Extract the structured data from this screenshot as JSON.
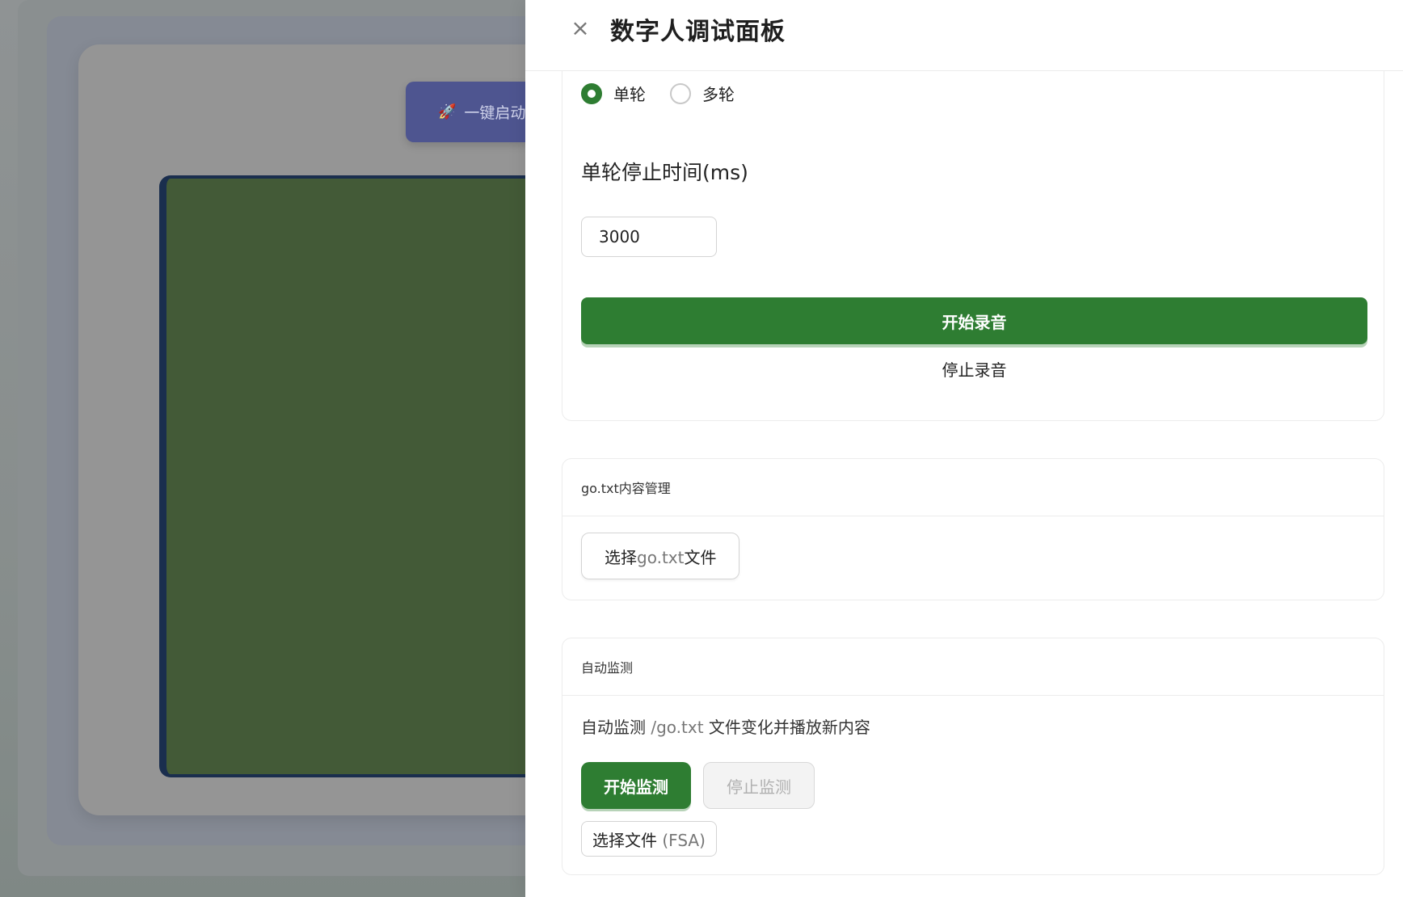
{
  "background": {
    "launch_button": {
      "icon": "rocket-icon",
      "label": "一键启动"
    }
  },
  "drawer": {
    "title": "数字人调试面板",
    "close_icon": "close-icon"
  },
  "record": {
    "mode_options": [
      "单轮",
      "多轮"
    ],
    "selected_mode": "单轮",
    "stop_time_label": "单轮停止时间(ms)",
    "stop_time_value": "3000",
    "start_label": "开始录音",
    "stop_label": "停止录音"
  },
  "gotxt": {
    "title": "go.txt内容管理",
    "select_prefix": "选择",
    "select_file": "go.txt",
    "select_suffix": "文件"
  },
  "monitor": {
    "title": "自动监测",
    "desc_prefix": "自动监测",
    "desc_path": "/go.txt",
    "desc_suffix": "文件变化并播放新内容",
    "start_label": "开始监测",
    "stop_label": "停止监测",
    "select_file_label": "选择文件",
    "select_file_hint": "(FSA)"
  },
  "colors": {
    "primary": "#2e7d32",
    "video_bg": "#435a37",
    "launch_btn": "#4e5590"
  }
}
